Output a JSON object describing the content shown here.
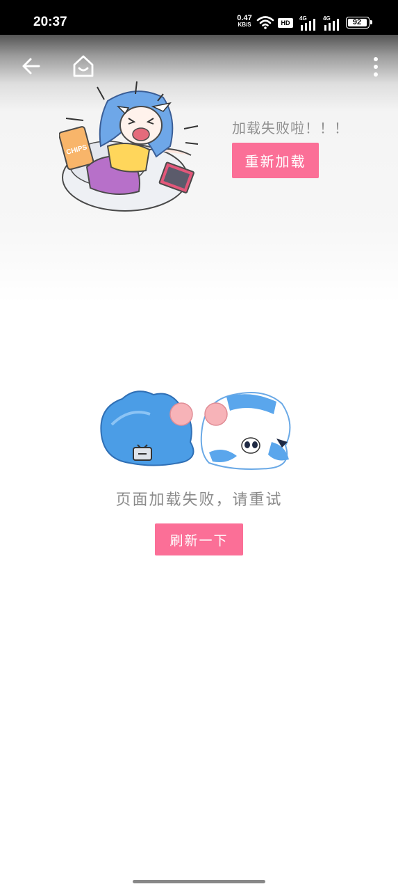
{
  "status_bar": {
    "time": "20:37",
    "net_speed_value": "0.47",
    "net_speed_unit": "KB/S",
    "hd_badge": "HD",
    "signal1_gen": "4G",
    "signal2_gen": "4G",
    "battery": "92",
    "icons": [
      "wifi-icon",
      "signal-icon",
      "signal-icon",
      "battery-icon"
    ]
  },
  "toolbar": {
    "icons": [
      "back-arrow-icon",
      "home-icon",
      "more-vertical-icon"
    ]
  },
  "top_panel": {
    "message": "加载失败啦！！！",
    "reload_label": "重新加载",
    "illustration_label": "CHIPS",
    "accent_color": "#fb6f97"
  },
  "main": {
    "message": "页面加载失败，请重试",
    "refresh_label": "刷新一下",
    "accent_color": "#fb6f97"
  }
}
